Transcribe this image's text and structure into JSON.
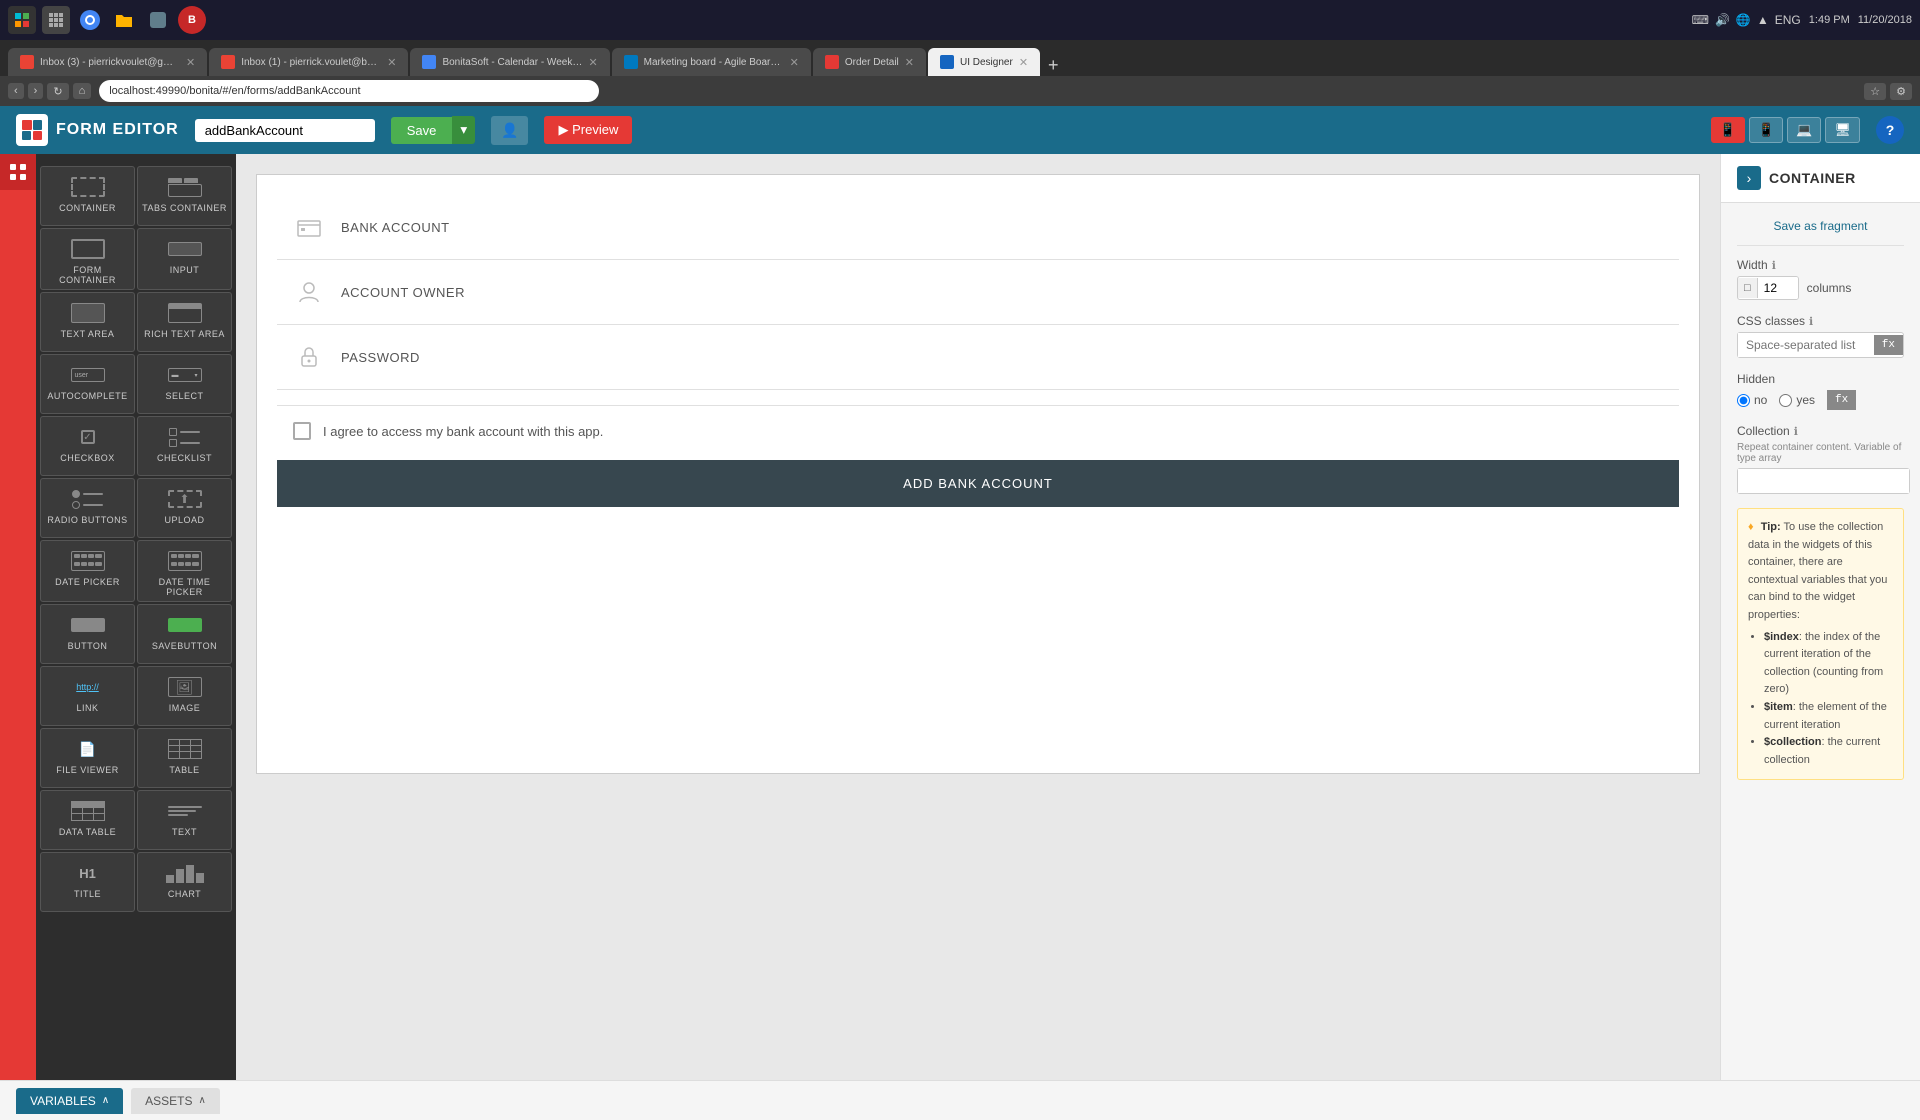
{
  "browser": {
    "address": "localhost:49990/bonita/#/en/forms/addBankAccount",
    "tabs": [
      {
        "id": "gmail1",
        "label": "Inbox (3) - pierrickvoulet@gmai...",
        "favicon": "gmail",
        "active": false
      },
      {
        "id": "gmail2",
        "label": "Inbox (1) - pierrick.voulet@boni...",
        "favicon": "gmail",
        "active": false
      },
      {
        "id": "bonita-cal",
        "label": "BonitaSoft - Calendar - Week of ...",
        "favicon": "bonita-cal",
        "active": false
      },
      {
        "id": "trello",
        "label": "Marketing board - Agile Board - ...",
        "favicon": "trello",
        "active": false
      },
      {
        "id": "order",
        "label": "Order Detail",
        "favicon": "order",
        "active": false
      },
      {
        "id": "ui-designer",
        "label": "UI Designer",
        "favicon": "ui-designer",
        "active": true
      }
    ]
  },
  "app": {
    "title": "FORM EDITOR",
    "form_name": "addBankAccount",
    "save_label": "Save",
    "preview_label": "▶ Preview"
  },
  "sidebar": {
    "widgets": [
      {
        "id": "container",
        "label": "CONTAINER",
        "type": "container"
      },
      {
        "id": "tabs-container",
        "label": "TABS CONTAINER",
        "type": "tabs"
      },
      {
        "id": "form-container",
        "label": "FORM CONTAINER",
        "type": "form-container"
      },
      {
        "id": "input",
        "label": "INPUT",
        "type": "input"
      },
      {
        "id": "text-area",
        "label": "TEXT AREA",
        "type": "textarea"
      },
      {
        "id": "rich-text-area",
        "label": "RICH TEXT AREA",
        "type": "rich-textarea"
      },
      {
        "id": "autocomplete",
        "label": "AUTOCOMPLETE",
        "type": "autocomplete"
      },
      {
        "id": "select",
        "label": "SELECT",
        "type": "select"
      },
      {
        "id": "checkbox",
        "label": "CHECKBOX",
        "type": "checkbox"
      },
      {
        "id": "checklist",
        "label": "CHECKLIST",
        "type": "checklist"
      },
      {
        "id": "radio-buttons",
        "label": "RADIO BUTTONS",
        "type": "radio"
      },
      {
        "id": "upload",
        "label": "UPLOAD",
        "type": "upload"
      },
      {
        "id": "date-picker",
        "label": "DATE PICKER",
        "type": "datepicker"
      },
      {
        "id": "date-time-picker",
        "label": "DATE TIME PICKER",
        "type": "datetimepicker"
      },
      {
        "id": "button",
        "label": "BUTTON",
        "type": "button"
      },
      {
        "id": "savebutton",
        "label": "SAVEBUTTON",
        "type": "savebutton"
      },
      {
        "id": "link",
        "label": "LINK",
        "type": "link"
      },
      {
        "id": "image",
        "label": "IMAGE",
        "type": "image"
      },
      {
        "id": "file-viewer",
        "label": "FILE VIEWER",
        "type": "fileviewer"
      },
      {
        "id": "table",
        "label": "TABLE",
        "type": "table"
      },
      {
        "id": "data-table",
        "label": "DATA TABLE",
        "type": "datatable"
      },
      {
        "id": "text",
        "label": "TEXT",
        "type": "text"
      },
      {
        "id": "title",
        "label": "TITLE",
        "type": "title"
      },
      {
        "id": "chart",
        "label": "CHART",
        "type": "chart"
      }
    ]
  },
  "canvas": {
    "fields": [
      {
        "id": "bank-account",
        "label": "BANK ACCOUNT",
        "icon": "bank"
      },
      {
        "id": "account-owner",
        "label": "ACCOUNT OWNER",
        "icon": "person"
      },
      {
        "id": "password",
        "label": "PASSWORD",
        "icon": "lock"
      }
    ],
    "checkbox_text": "I agree to access my bank account with this app.",
    "add_button_label": "ADD BANK ACCOUNT"
  },
  "right_panel": {
    "title": "CONTAINER",
    "save_fragment_label": "Save as fragment",
    "width_label": "Width",
    "width_value": "12",
    "columns_label": "columns",
    "css_classes_label": "CSS classes",
    "css_placeholder": "Space-separated list",
    "hidden_label": "Hidden",
    "hidden_no": "no",
    "hidden_yes": "yes",
    "collection_label": "Collection",
    "collection_description": "Repeat container content. Variable of type array",
    "binding_symbol": "fx",
    "tip_title": "Tip",
    "tip_text": "To use the collection data in the widgets of this container, there are contextual variables that you can bind to the widget properties:",
    "tip_items": [
      "$index: the index of the current iteration of the collection (counting from zero)",
      "$item: the element of the current iteration",
      "$collection: the current collection"
    ]
  },
  "bottom_bar": {
    "variables_tab": "VARIABLES",
    "assets_tab": "ASSETS"
  },
  "time": "1:49 PM",
  "date": "11/20/2018"
}
